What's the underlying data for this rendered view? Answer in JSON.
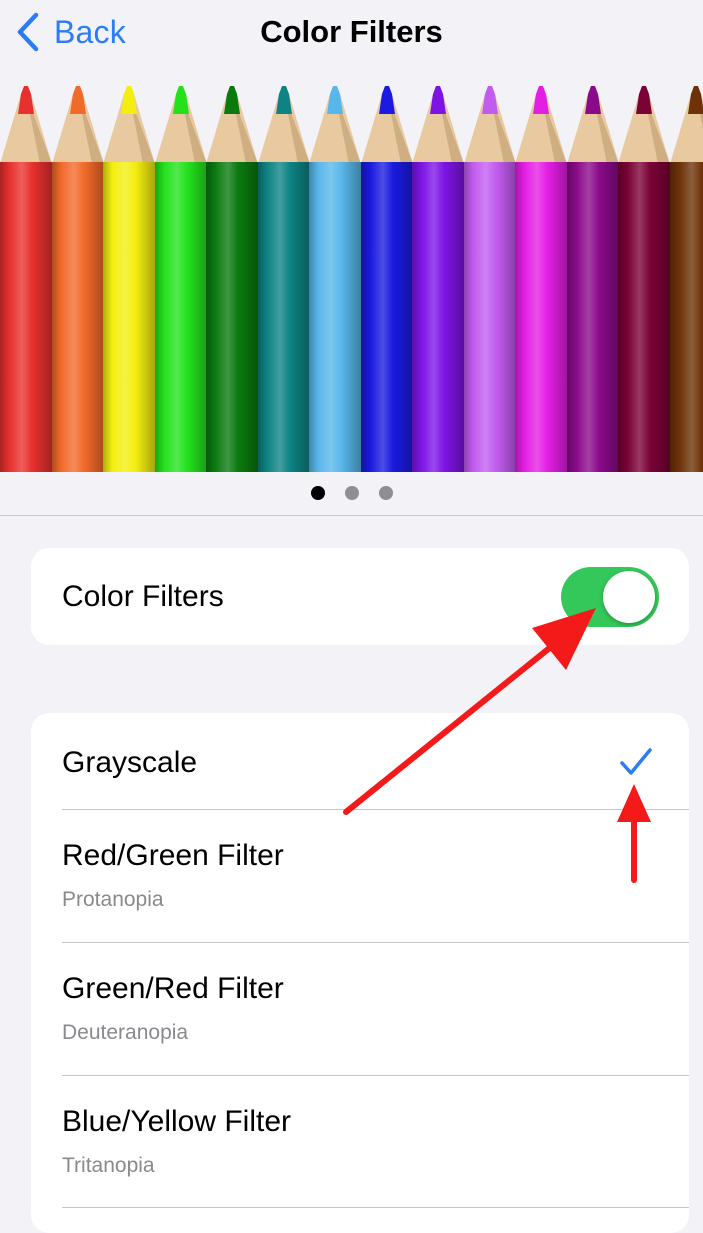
{
  "nav": {
    "back_label": "Back",
    "title": "Color Filters"
  },
  "gallery": {
    "pencil_colors": [
      "#e8312e",
      "#f26a2a",
      "#f3ee10",
      "#23e21c",
      "#0a7a0f",
      "#0d8383",
      "#58b7ea",
      "#1a1ae0",
      "#7d14e5",
      "#c25cf0",
      "#e51ee5",
      "#8a0a8a",
      "#7a0236",
      "#6d3207"
    ],
    "page_count": 3,
    "active_page": 0
  },
  "color_filters_toggle": {
    "label": "Color Filters",
    "on": true,
    "on_color": "#34c759"
  },
  "filters": [
    {
      "title": "Grayscale",
      "subtitle": "",
      "selected": true
    },
    {
      "title": "Red/Green Filter",
      "subtitle": "Protanopia",
      "selected": false
    },
    {
      "title": "Green/Red Filter",
      "subtitle": "Deuteranopia",
      "selected": false
    },
    {
      "title": "Blue/Yellow Filter",
      "subtitle": "Tritanopia",
      "selected": false
    }
  ],
  "colors": {
    "accent": "#2b7cf6",
    "annotation_arrow": "#f41a1a"
  }
}
